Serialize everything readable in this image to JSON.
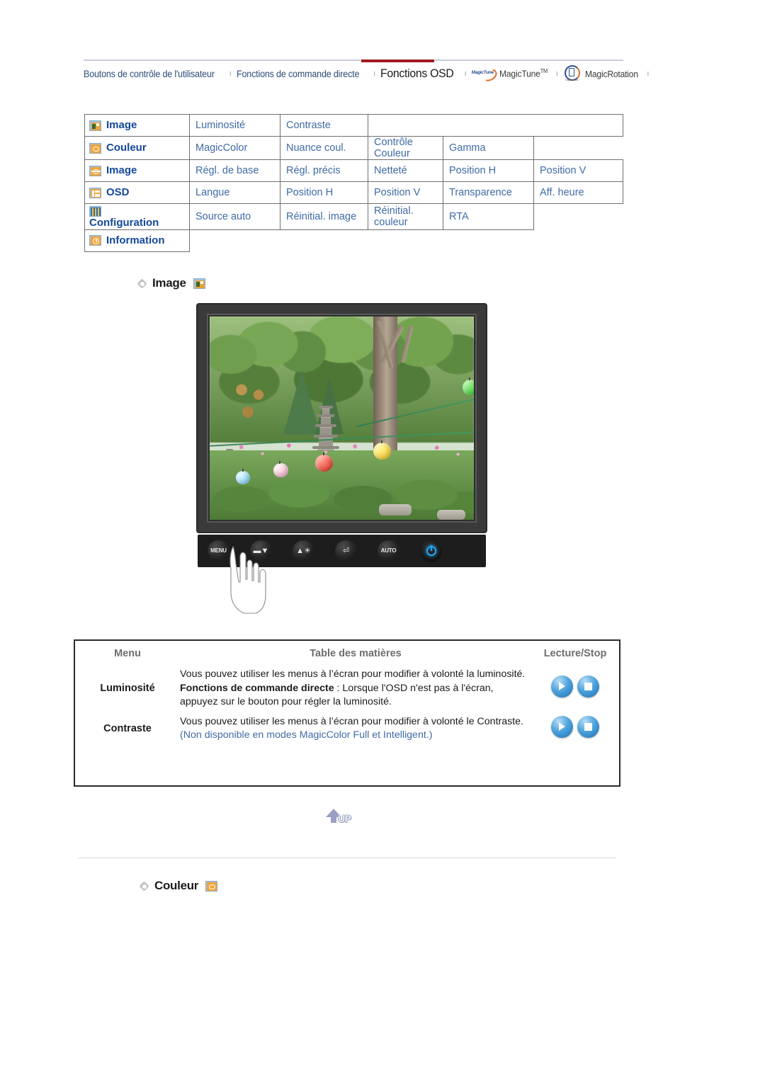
{
  "topnav": {
    "items": [
      {
        "label": "Boutons de contrôle de l'utilisateur",
        "active": false
      },
      {
        "label": "Fonctions de commande directe",
        "active": false
      },
      {
        "label": "Fonctions OSD",
        "active": true
      },
      {
        "label": "MagicTune",
        "active": false,
        "tm": "TM",
        "icon": "magictune-logo-icon"
      },
      {
        "label": "MagicRotation",
        "active": false,
        "icon": "magicrotation-logo-icon"
      }
    ],
    "separator": "ı",
    "active_accent_color": "#a01c22",
    "link_color": "#2b4d77"
  },
  "osd_table": {
    "text_color": "#3e6ba5",
    "category_color": "#14489a",
    "rows": [
      {
        "icon": "image-brightness-icon",
        "category": "Image",
        "items": [
          "Luminosité",
          "Contraste"
        ]
      },
      {
        "icon": "color-palette-icon",
        "category": "Couleur",
        "items": [
          "MagicColor",
          "Nuance coul.",
          "Contrôle Couleur",
          "Gamma"
        ]
      },
      {
        "icon": "image-geometry-icon",
        "category": "Image",
        "items": [
          "Régl. de base",
          "Régl. précis",
          "Netteté",
          "Position H",
          "Position V"
        ]
      },
      {
        "icon": "osd-window-icon",
        "category": "OSD",
        "items": [
          "Langue",
          "Position H",
          "Position V",
          "Transparence",
          "Aff. heure"
        ]
      },
      {
        "icon": "configuration-sliders-icon",
        "category": "Configuration",
        "items": [
          "Source auto",
          "Réinitial. image",
          "Réinitial. couleur",
          "RTA"
        ]
      },
      {
        "icon": "information-clock-icon",
        "category": "Information",
        "items": []
      }
    ]
  },
  "sections": {
    "image": {
      "label": "Image",
      "icon": "image-brightness-icon"
    },
    "couleur": {
      "label": "Couleur",
      "icon": "color-palette-icon"
    }
  },
  "monitor": {
    "screen_alt": "Jardin avec pagode de pierre et lanternes colorées",
    "buttons": [
      {
        "name": "menu-button",
        "label": "MENU"
      },
      {
        "name": "down-up-button",
        "label": ""
      },
      {
        "name": "brightness-button",
        "label": ""
      },
      {
        "name": "enter-button",
        "label": ""
      },
      {
        "name": "auto-button",
        "label": "AUTO"
      },
      {
        "name": "power-button",
        "label": ""
      }
    ]
  },
  "desc_table": {
    "headers": {
      "menu": "Menu",
      "contents": "Table des matières",
      "play_stop": "Lecture/Stop"
    },
    "rows": [
      {
        "menu": "Luminosité",
        "line1": "Vous pouvez utiliser les menus à l’écran pour modifier à volonté la luminosité.",
        "bold_lead": "Fonctions de commande directe",
        "line2": " : Lorsque l'OSD n'est pas à l'écran, appuyez sur le bouton pour régler la luminosité.",
        "note": "",
        "buttons": [
          "play-button",
          "stop-button"
        ]
      },
      {
        "menu": "Contraste",
        "line1": "Vous pouvez utiliser les menus à l’écran pour modifier à volonté le Contraste.",
        "bold_lead": "",
        "line2": "",
        "note": "(Non disponible en modes MagicColor Full et Intelligent.)",
        "buttons": [
          "play-button",
          "stop-button"
        ]
      }
    ]
  },
  "up_button": {
    "label": "UP"
  }
}
